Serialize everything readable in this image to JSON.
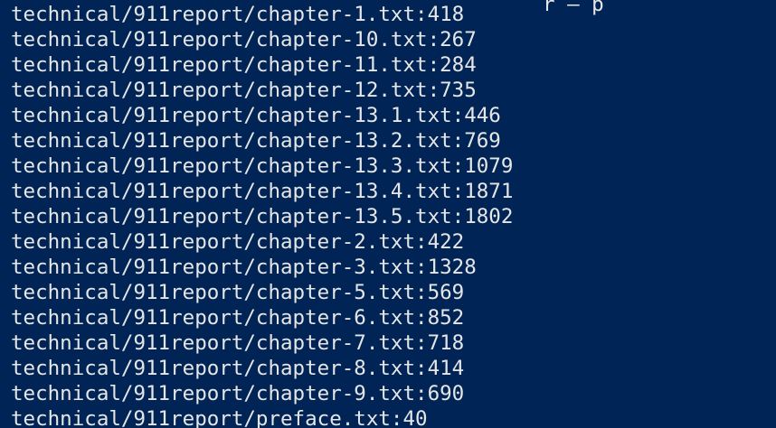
{
  "terminal": {
    "background_color": "#012456",
    "text_color": "#e6e6e6",
    "partial_top_line": "r — p",
    "lines": [
      "technical/911report/chapter-1.txt:418",
      "technical/911report/chapter-10.txt:267",
      "technical/911report/chapter-11.txt:284",
      "technical/911report/chapter-12.txt:735",
      "technical/911report/chapter-13.1.txt:446",
      "technical/911report/chapter-13.2.txt:769",
      "technical/911report/chapter-13.3.txt:1079",
      "technical/911report/chapter-13.4.txt:1871",
      "technical/911report/chapter-13.5.txt:1802",
      "technical/911report/chapter-2.txt:422",
      "technical/911report/chapter-3.txt:1328",
      "technical/911report/chapter-5.txt:569",
      "technical/911report/chapter-6.txt:852",
      "technical/911report/chapter-7.txt:718",
      "technical/911report/chapter-8.txt:414",
      "technical/911report/chapter-9.txt:690",
      "technical/911report/preface.txt:40"
    ]
  }
}
